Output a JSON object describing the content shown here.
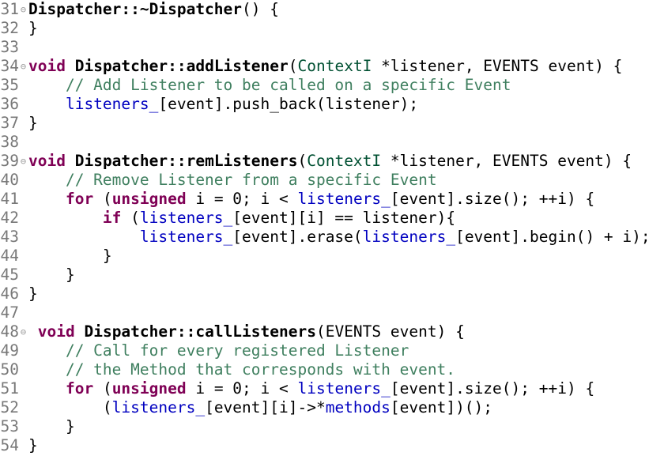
{
  "colors": {
    "default": "#000000",
    "keyword": "#7f0055",
    "field": "#0000c0",
    "comment": "#3f7f5f",
    "type": "#005032",
    "line_number": "#787878",
    "fold_marker": "#9a9a9a"
  },
  "icons": {
    "fold": "collapse-fold-icon"
  },
  "lines": [
    {
      "n": "31",
      "fold": "⊖",
      "tokens": [
        {
          "t": "Dispatcher::~Dispatcher",
          "c": "default",
          "b": true
        },
        {
          "t": "() {",
          "c": "default"
        }
      ]
    },
    {
      "n": "32",
      "tokens": [
        {
          "t": "}",
          "c": "default"
        }
      ]
    },
    {
      "n": "33",
      "tokens": []
    },
    {
      "n": "34",
      "fold": "⊖",
      "tokens": [
        {
          "t": "void",
          "c": "keyword",
          "b": true
        },
        {
          "t": " ",
          "c": "default"
        },
        {
          "t": "Dispatcher::addListener",
          "c": "default",
          "b": true
        },
        {
          "t": "(",
          "c": "default"
        },
        {
          "t": "ContextI",
          "c": "type"
        },
        {
          "t": " *listener, EVENTS event) {",
          "c": "default"
        }
      ]
    },
    {
      "n": "35",
      "tokens": [
        {
          "t": "    // Add Listener to be called on a specific Event",
          "c": "comment"
        }
      ]
    },
    {
      "n": "36",
      "tokens": [
        {
          "t": "    ",
          "c": "default"
        },
        {
          "t": "listeners_",
          "c": "field"
        },
        {
          "t": "[event].push_back(listener);",
          "c": "default"
        }
      ]
    },
    {
      "n": "37",
      "tokens": [
        {
          "t": "}",
          "c": "default"
        }
      ]
    },
    {
      "n": "38",
      "tokens": []
    },
    {
      "n": "39",
      "fold": "⊖",
      "tokens": [
        {
          "t": "void",
          "c": "keyword",
          "b": true
        },
        {
          "t": " ",
          "c": "default"
        },
        {
          "t": "Dispatcher::remListeners",
          "c": "default",
          "b": true
        },
        {
          "t": "(",
          "c": "default"
        },
        {
          "t": "ContextI",
          "c": "type"
        },
        {
          "t": " *listener, EVENTS event) {",
          "c": "default"
        }
      ]
    },
    {
      "n": "40",
      "tokens": [
        {
          "t": "    // Remove Listener from a specific Event",
          "c": "comment"
        }
      ]
    },
    {
      "n": "41",
      "tokens": [
        {
          "t": "    ",
          "c": "default"
        },
        {
          "t": "for",
          "c": "keyword",
          "b": true
        },
        {
          "t": " (",
          "c": "default"
        },
        {
          "t": "unsigned",
          "c": "keyword",
          "b": true
        },
        {
          "t": " i = 0; i < ",
          "c": "default"
        },
        {
          "t": "listeners_",
          "c": "field"
        },
        {
          "t": "[event].size(); ++i) {",
          "c": "default"
        }
      ]
    },
    {
      "n": "42",
      "tokens": [
        {
          "t": "        ",
          "c": "default"
        },
        {
          "t": "if",
          "c": "keyword",
          "b": true
        },
        {
          "t": " (",
          "c": "default"
        },
        {
          "t": "listeners_",
          "c": "field"
        },
        {
          "t": "[event][i] == listener){",
          "c": "default"
        }
      ]
    },
    {
      "n": "43",
      "tokens": [
        {
          "t": "            ",
          "c": "default"
        },
        {
          "t": "listeners_",
          "c": "field"
        },
        {
          "t": "[event].erase(",
          "c": "default"
        },
        {
          "t": "listeners_",
          "c": "field"
        },
        {
          "t": "[event].begin() + i);",
          "c": "default"
        }
      ]
    },
    {
      "n": "44",
      "tokens": [
        {
          "t": "        }",
          "c": "default"
        }
      ]
    },
    {
      "n": "45",
      "tokens": [
        {
          "t": "    }",
          "c": "default"
        }
      ]
    },
    {
      "n": "46",
      "tokens": [
        {
          "t": "}",
          "c": "default"
        }
      ]
    },
    {
      "n": "47",
      "tokens": []
    },
    {
      "n": "48",
      "fold": "⊖",
      "tokens": [
        {
          "t": " ",
          "c": "default"
        },
        {
          "t": "void",
          "c": "keyword",
          "b": true
        },
        {
          "t": " ",
          "c": "default"
        },
        {
          "t": "Dispatcher::callListeners",
          "c": "default",
          "b": true
        },
        {
          "t": "(EVENTS event) {",
          "c": "default"
        }
      ]
    },
    {
      "n": "49",
      "tokens": [
        {
          "t": "    // Call for every registered Listener",
          "c": "comment"
        }
      ]
    },
    {
      "n": "50",
      "tokens": [
        {
          "t": "    // the Method that corresponds with event.",
          "c": "comment"
        }
      ]
    },
    {
      "n": "51",
      "tokens": [
        {
          "t": "    ",
          "c": "default"
        },
        {
          "t": "for",
          "c": "keyword",
          "b": true
        },
        {
          "t": " (",
          "c": "default"
        },
        {
          "t": "unsigned",
          "c": "keyword",
          "b": true
        },
        {
          "t": " i = 0; i < ",
          "c": "default"
        },
        {
          "t": "listeners_",
          "c": "field"
        },
        {
          "t": "[event].size(); ++i) {",
          "c": "default"
        }
      ]
    },
    {
      "n": "52",
      "tokens": [
        {
          "t": "        (",
          "c": "default"
        },
        {
          "t": "listeners_",
          "c": "field"
        },
        {
          "t": "[event][i]->*",
          "c": "default"
        },
        {
          "t": "methods",
          "c": "field"
        },
        {
          "t": "[event])();",
          "c": "default"
        }
      ]
    },
    {
      "n": "53",
      "tokens": [
        {
          "t": "    }",
          "c": "default"
        }
      ]
    },
    {
      "n": "54",
      "tokens": [
        {
          "t": "}",
          "c": "default"
        }
      ]
    }
  ]
}
